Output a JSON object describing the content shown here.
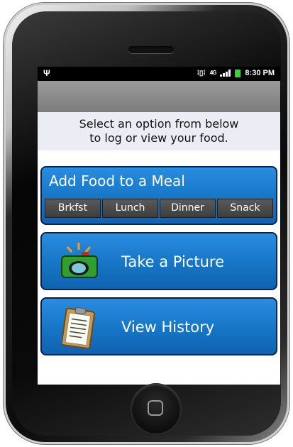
{
  "status_bar": {
    "time": "8:30 PM",
    "network": "4G",
    "icons": [
      "usb-icon",
      "vibrate-icon",
      "network-type-icon",
      "signal-icon",
      "battery-charging-icon"
    ]
  },
  "prompt": {
    "line1": "Select an option from below",
    "line2": "to log or view your food."
  },
  "add_food": {
    "title": "Add Food to a Meal",
    "meals": [
      "Brkfst",
      "Lunch",
      "Dinner",
      "Snack"
    ]
  },
  "take_picture": {
    "label": "Take a Picture",
    "icon": "camera-icon"
  },
  "view_history": {
    "label": "View History",
    "icon": "clipboard-icon"
  },
  "colors": {
    "card_blue": "#1877c8",
    "card_border": "#07224a",
    "meal_button": "#4a4a4a",
    "prompt_bg": "#ecedf4",
    "camera_green": "#2f9f2f"
  }
}
